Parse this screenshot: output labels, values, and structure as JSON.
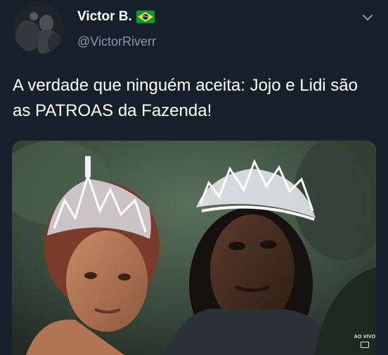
{
  "tweet": {
    "author": {
      "display_name": "Victor B.",
      "handle": "@VictorRiverr",
      "badge": "brazil-flag",
      "avatar": "avatar-photo"
    },
    "menu_icon": "chevron-down-icon",
    "text": "A verdade que ninguém aceita: Jojo e Lidi são as PATROAS da Fazenda!",
    "media": {
      "description_icon": "photo",
      "overlay_label": "AO VIVO"
    }
  },
  "colors": {
    "background": "#15202b",
    "text": "#ffffff",
    "secondary_text": "#8899a6",
    "flag_green": "#009c3b",
    "flag_yellow": "#ffdf00",
    "flag_blue": "#002776"
  }
}
